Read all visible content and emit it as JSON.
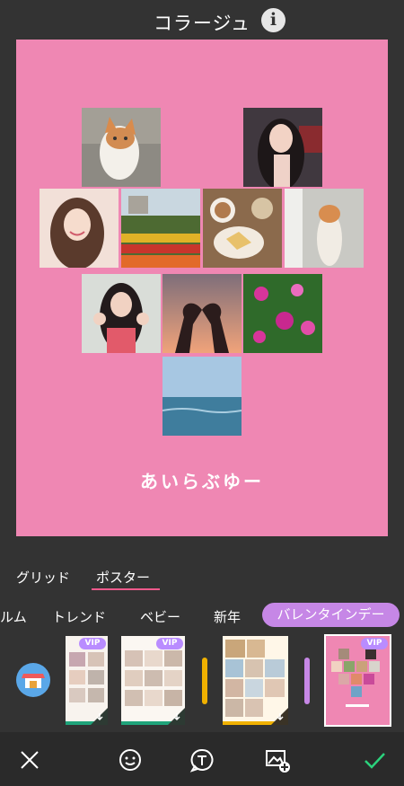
{
  "header": {
    "title": "コラージュ",
    "info_glyph": "i"
  },
  "canvas": {
    "caption": "あいらぶゆー",
    "background": "#ef87b3"
  },
  "tabs": [
    {
      "label": "グリッド",
      "active": false
    },
    {
      "label": "ポスター",
      "active": true
    }
  ],
  "categories": [
    {
      "label": "ルム"
    },
    {
      "label": "トレンド"
    },
    {
      "label": "ベビー"
    },
    {
      "label": "新年"
    },
    {
      "label": "バレンタインデー",
      "active": true
    }
  ],
  "templates": [
    {
      "badge": "VIP",
      "accent": "#1fa37a"
    },
    {
      "badge": "VIP",
      "accent": "#1fa37a"
    },
    {
      "badge": "",
      "accent": "#f0b100"
    },
    {
      "badge": "VIP",
      "accent": "#ef87b3",
      "selected": true
    }
  ],
  "colors": {
    "accent_pink": "#ef5a8c",
    "chip_purple": "#c687e6",
    "check_green": "#2bd27c"
  }
}
